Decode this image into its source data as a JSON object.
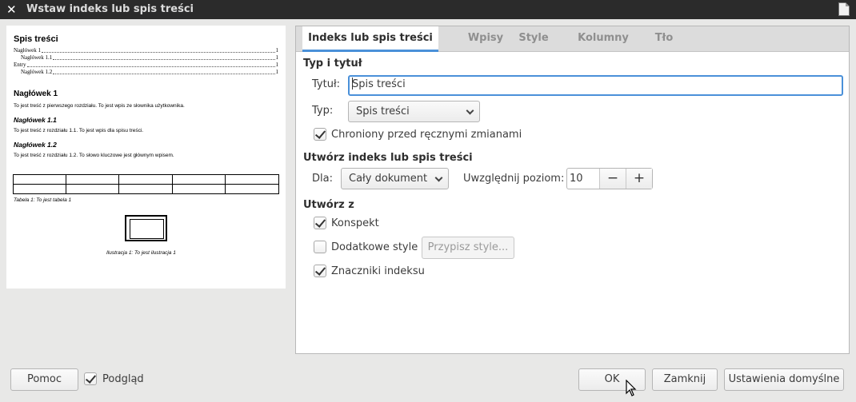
{
  "window": {
    "title": "Wstaw indeks lub spis treści",
    "close_glyph": "✕",
    "app_icon": "document-icon"
  },
  "preview": {
    "toc_title": "Spis treści",
    "toc_entries": [
      {
        "text": "Nagłówek 1",
        "page": "1"
      },
      {
        "text": "Nagłówek 1.1",
        "page": "1"
      },
      {
        "text": "Entry",
        "page": "1"
      },
      {
        "text": "Nagłówek 1.2",
        "page": "1"
      }
    ],
    "heading1": "Nagłówek 1",
    "body1": "To jest treść z pierwszego rozdziału. To jest wpis ze słownika użytkownika.",
    "heading11": "Nagłówek 1.1",
    "body11": "To jest treść z rozdziału 1.1. To jest wpis dla spisu treści.",
    "heading12": "Nagłówek 1.2",
    "body12": "To jest treść z rozdziału 1.2. To słowo kluczowe jest głównym wpisem.",
    "table_caption": "Tabela 1: To jest tabela 1",
    "illustration_caption": "Ilustracja 1: To jest ilustracja 1"
  },
  "tabs": [
    {
      "label": "Indeks lub spis treści",
      "active": true
    },
    {
      "label": "Wpisy",
      "active": false
    },
    {
      "label": "Style",
      "active": false
    },
    {
      "label": "Kolumny",
      "active": false
    },
    {
      "label": "Tło",
      "active": false
    }
  ],
  "type_title": {
    "section": "Typ i tytuł",
    "title_label": "Tytuł:",
    "title_value": "Spis treści",
    "type_label": "Typ:",
    "type_value": "Spis treści",
    "protected_label": "Chroniony przed ręcznymi zmianami",
    "protected_checked": true
  },
  "create_index": {
    "section": "Utwórz indeks lub spis treści",
    "for_label": "Dla:",
    "for_value": "Cały dokument",
    "level_label": "Uwzględnij poziom:",
    "level_value": "10",
    "minus": "−",
    "plus": "+"
  },
  "create_from": {
    "section": "Utwórz z",
    "outline_label": "Konspekt",
    "outline_checked": true,
    "additional_label": "Dodatkowe style",
    "additional_checked": false,
    "assign_styles_label": "Przypisz style...",
    "index_marks_label": "Znaczniki indeksu",
    "index_marks_checked": true
  },
  "footer": {
    "help": "Pomoc",
    "preview_label": "Podgląd",
    "preview_checked": true,
    "ok": "OK",
    "close": "Zamknij",
    "reset": "Ustawienia domyślne"
  },
  "colors": {
    "titlebar": "#2b2b2b",
    "accent": "#4a90d9",
    "dialog_bg": "#e8e8e7"
  }
}
